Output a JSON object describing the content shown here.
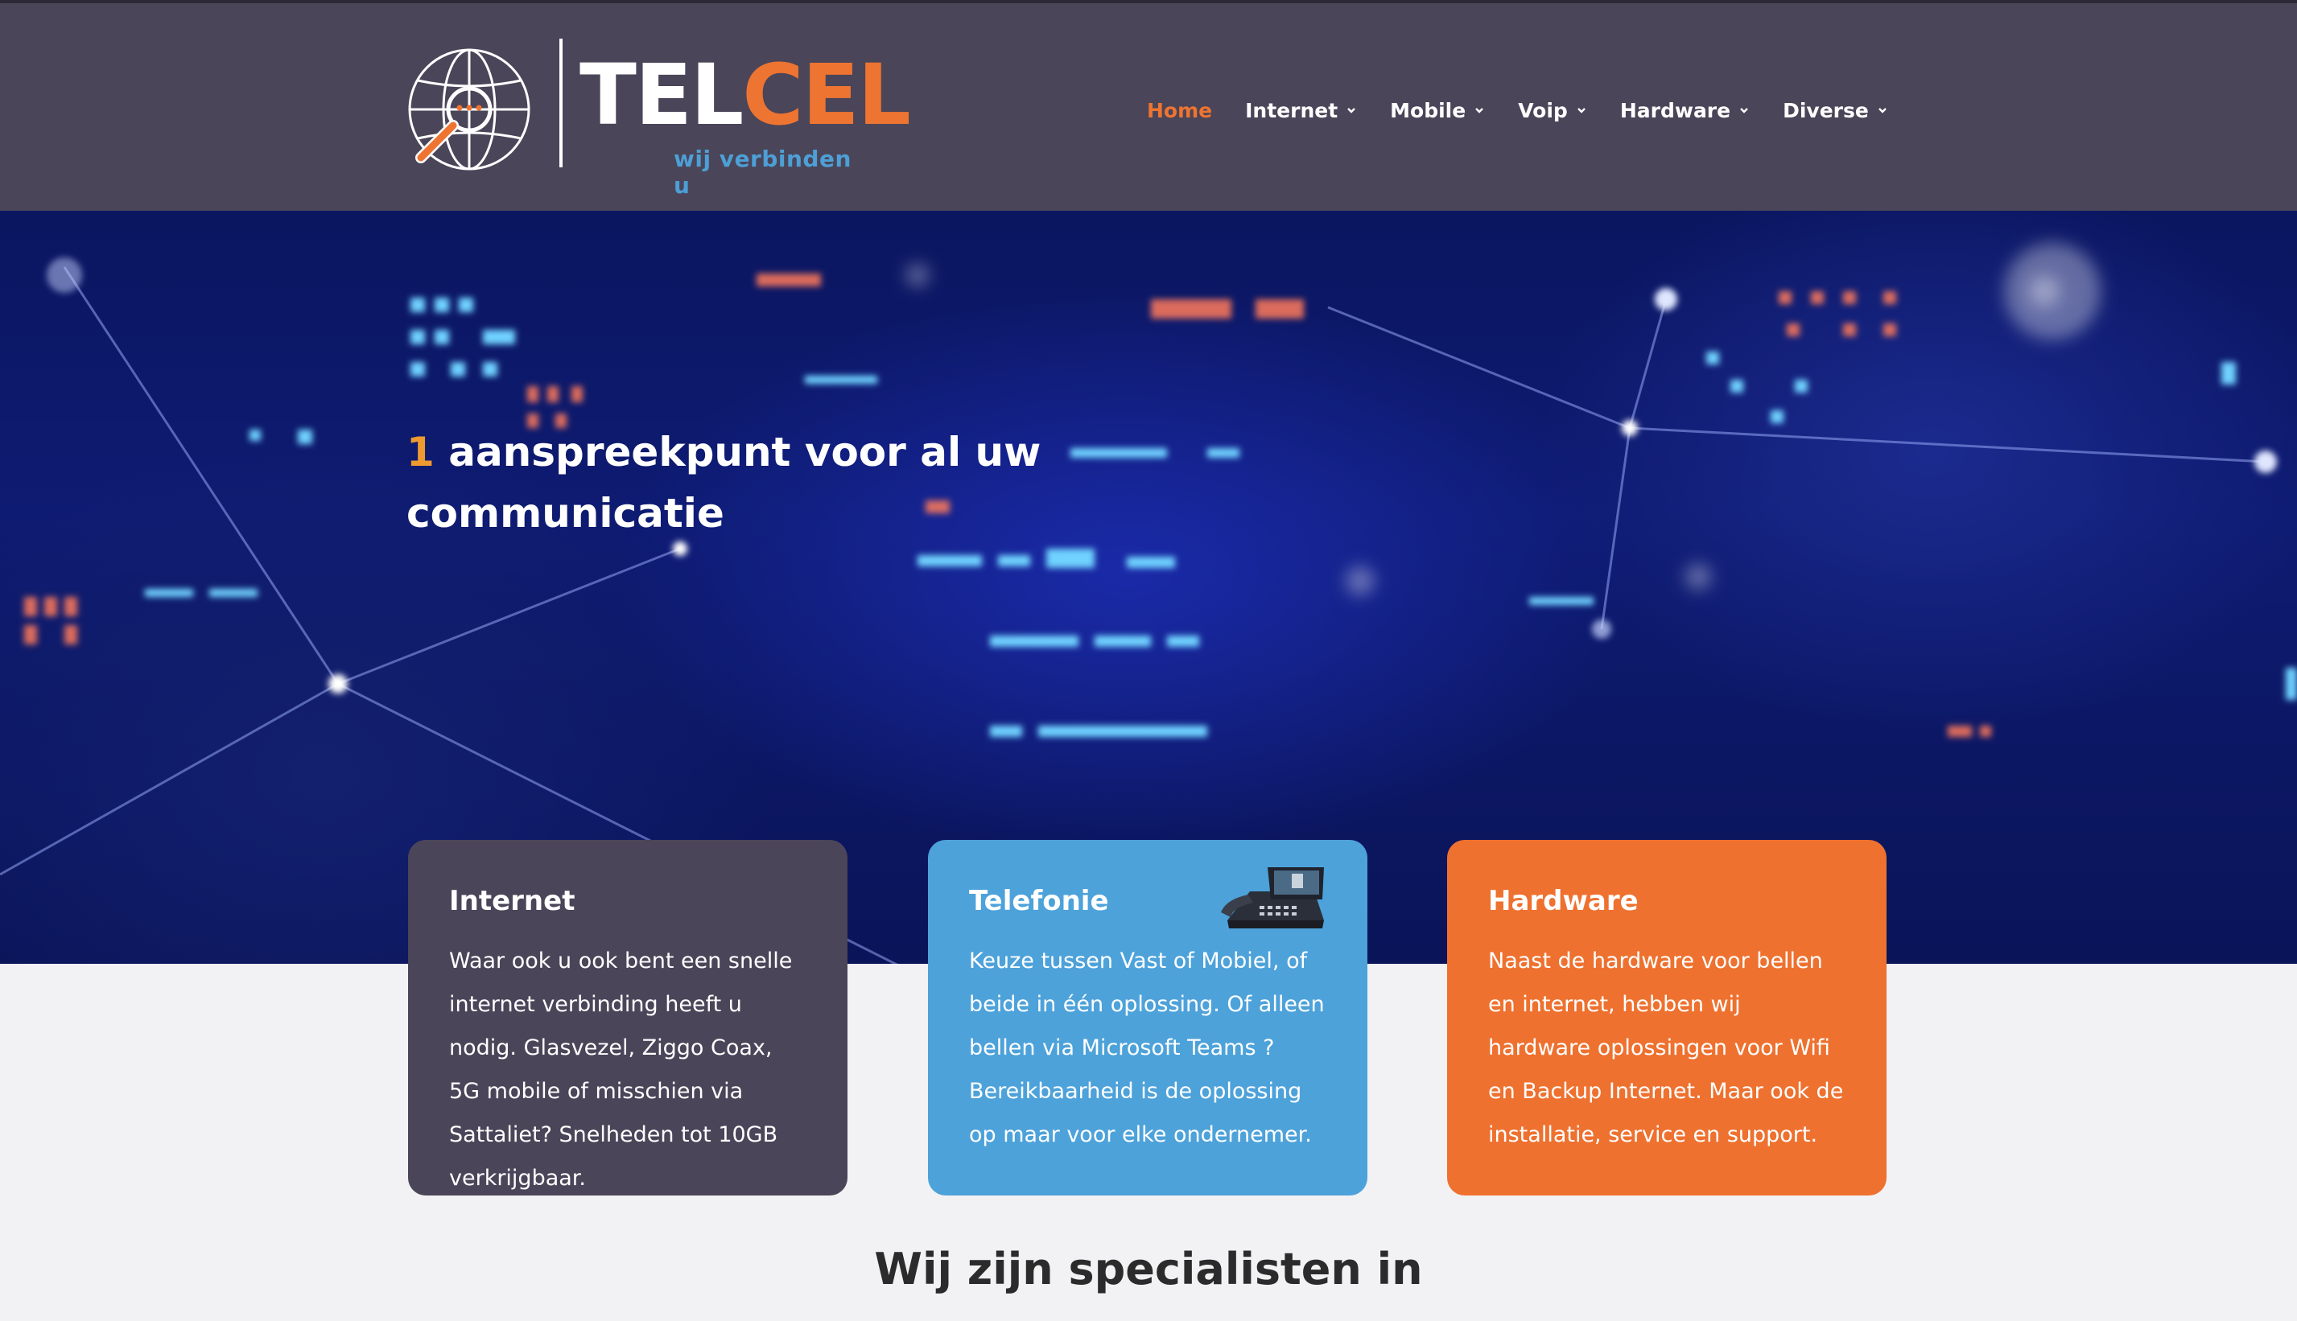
{
  "brand": {
    "name_part1": "TEL",
    "name_part2": "CEL",
    "tagline": "wij verbinden u",
    "colors": {
      "dark": "#4a4558",
      "orange": "#ee7431",
      "blue": "#4da2da",
      "hero_accent": "#ee9a30"
    }
  },
  "nav": {
    "items": [
      {
        "label": "Home",
        "active": true,
        "has_dropdown": false
      },
      {
        "label": "Internet",
        "active": false,
        "has_dropdown": true
      },
      {
        "label": "Mobile",
        "active": false,
        "has_dropdown": true
      },
      {
        "label": "Voip",
        "active": false,
        "has_dropdown": true
      },
      {
        "label": "Hardware",
        "active": false,
        "has_dropdown": true
      },
      {
        "label": "Diverse",
        "active": false,
        "has_dropdown": true
      }
    ]
  },
  "hero": {
    "title_accent": "1",
    "title_rest": " aanspreekpunt voor al uw communicatie"
  },
  "cards": [
    {
      "title": "Internet",
      "text": "Waar ook u ook bent een snelle internet verbinding heeft u nodig. Glasvezel, Ziggo Coax, 5G mobile of misschien via Sattaliet? Snelheden tot 10GB verkrijgbaar."
    },
    {
      "title": "Telefonie",
      "icon": "desk-phone-icon",
      "text": "Keuze  tussen Vast of Mobiel, of beide in één oplossing. Of alleen bellen via Microsoft Teams ? Bereikbaarheid is de oplossing op maar voor elke ondernemer."
    },
    {
      "title": "Hardware",
      "text": "Naast de hardware voor bellen en internet, hebben wij hardware oplossingen  voor Wifi en Backup Internet. Maar ook de installatie, service en support."
    }
  ],
  "section": {
    "title": "Wij zijn specialisten in"
  }
}
